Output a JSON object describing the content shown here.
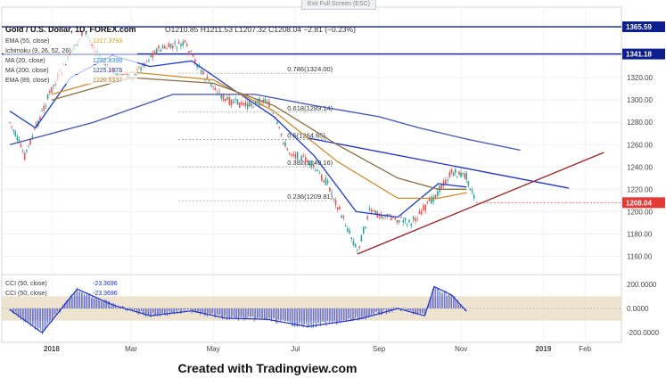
{
  "header": {
    "exit_fullscreen": "Exit Full Screen (ESC)",
    "symbol": "Gold / U.S. Dollar, 1D, FOREX.com",
    "ohlc": "O1210.85  H1211.53  L1207.32  C1208.04  −2.81 (−0.23%)"
  },
  "legend": [
    {
      "label": "EMA (55, close)",
      "value": "1217.3793",
      "color": "#d4a017"
    },
    {
      "label": "Ichimoku (9, 26, 52, 26)",
      "value": "",
      "color": "#1e88e5"
    },
    {
      "label": "MA (20, close)",
      "value": "1222.8398",
      "color": "#1e88e5"
    },
    {
      "label": "MA (200, close)",
      "value": "1225.1875",
      "color": "#2e3f9e"
    },
    {
      "label": "EMA (89, close)",
      "value": "1220.5337",
      "color": "#b07a2a"
    }
  ],
  "price_axis_ticks": [
    "1340.00",
    "1320.00",
    "1300.00",
    "1280.00",
    "1260.00",
    "1240.00",
    "1220.00",
    "1200.00",
    "1180.00",
    "1160.00"
  ],
  "price_badges": [
    {
      "text": "1365.59",
      "bg": "#0b1f8f"
    },
    {
      "text": "1341.18",
      "bg": "#0b1f8f"
    },
    {
      "text": "1208.04",
      "bg": "#e53935"
    }
  ],
  "fib_levels": [
    "0.786(1324.00)",
    "0.618(1289.14)",
    "0.5(1264.65)",
    "0.382(1240.16)",
    "0.236(1209.81)"
  ],
  "cci_legend": [
    {
      "label": "CCI (50, close)",
      "value": "-23.3696"
    },
    {
      "label": "CCI (50, close)",
      "value": "-23.3696"
    }
  ],
  "cci_axis_ticks": [
    "200.0000",
    "0.0000",
    "-200.0000"
  ],
  "time_axis_labels": [
    "2018",
    "Mar",
    "May",
    "Jul",
    "Sep",
    "Nov",
    "2019",
    "Feb"
  ],
  "caption": "Created with Tradingview.com",
  "colors": {
    "up_candle": "#26a69a",
    "down_candle": "#ef5350",
    "ma20": "#1a3bd6",
    "ma200": "#3f51b5",
    "ema55": "#d08a2c",
    "ema89": "#8d6e3f",
    "horizontal_lines": "#0b1f8f",
    "resistance_trendline": "#1a2fd0",
    "support_trendline": "#9b1c1c",
    "cci_line": "#1a2fd0",
    "cci_band": "#e8dcc3"
  },
  "chart_data": {
    "type": "line",
    "title": "Gold / U.S. Dollar, 1D, FOREX.com",
    "y_range": [
      1150,
      1372
    ],
    "x_labels": [
      "2018",
      "Mar",
      "May",
      "Jul",
      "Sep",
      "Nov",
      "2019",
      "Feb"
    ],
    "series": [
      {
        "name": "Gold / U.S. Dollar",
        "x": [
          "2017-12-01",
          "2017-12-12",
          "2018-01-01",
          "2018-01-25",
          "2018-02-10",
          "2018-03-01",
          "2018-03-20",
          "2018-04-10",
          "2018-04-25",
          "2018-05-10",
          "2018-05-25",
          "2018-06-10",
          "2018-06-25",
          "2018-07-10",
          "2018-07-25",
          "2018-08-16",
          "2018-08-25",
          "2018-09-10",
          "2018-09-25",
          "2018-10-10",
          "2018-10-25",
          "2018-11-05",
          "2018-11-12"
        ],
        "values": [
          1280,
          1250,
          1310,
          1362,
          1330,
          1320,
          1345,
          1350,
          1320,
          1300,
          1295,
          1300,
          1255,
          1245,
          1225,
          1165,
          1200,
          1195,
          1190,
          1210,
          1235,
          1232,
          1208
        ]
      },
      {
        "name": "MA (20, close)",
        "x": [
          "2017-12-01",
          "2017-12-20",
          "2018-01-15",
          "2018-02-15",
          "2018-03-15",
          "2018-04-15",
          "2018-05-15",
          "2018-06-15",
          "2018-07-15",
          "2018-08-15",
          "2018-09-15",
          "2018-10-15",
          "2018-11-05"
        ],
        "values": [
          1290,
          1275,
          1320,
          1340,
          1330,
          1335,
          1310,
          1285,
          1250,
          1200,
          1195,
          1225,
          1222
        ]
      },
      {
        "name": "MA (200, close)",
        "x": [
          "2017-12-01",
          "2018-02-01",
          "2018-04-01",
          "2018-06-01",
          "2018-07-15",
          "2018-09-01",
          "2018-10-01",
          "2018-11-05",
          "2018-12-15"
        ],
        "values": [
          1260,
          1280,
          1305,
          1305,
          1295,
          1285,
          1275,
          1265,
          1255
        ]
      },
      {
        "name": "EMA (55, close)",
        "x": [
          "2018-01-01",
          "2018-03-01",
          "2018-05-01",
          "2018-06-15",
          "2018-08-01",
          "2018-09-15",
          "2018-10-15",
          "2018-11-05"
        ],
        "values": [
          1305,
          1325,
          1318,
          1290,
          1245,
          1212,
          1212,
          1217
        ]
      },
      {
        "name": "EMA (89, close)",
        "x": [
          "2018-01-01",
          "2018-03-01",
          "2018-05-01",
          "2018-06-15",
          "2018-08-01",
          "2018-09-15",
          "2018-10-15",
          "2018-11-05"
        ],
        "values": [
          1300,
          1320,
          1315,
          1295,
          1260,
          1230,
          1220,
          1220
        ]
      }
    ],
    "horizontal_levels": [
      1365.59,
      1341.18
    ],
    "fib_retracements": [
      {
        "ratio": 0.786,
        "value": 1324.0
      },
      {
        "ratio": 0.618,
        "value": 1289.14
      },
      {
        "ratio": 0.5,
        "value": 1264.65
      },
      {
        "ratio": 0.382,
        "value": 1240.16
      },
      {
        "ratio": 0.236,
        "value": 1209.81
      }
    ],
    "trendlines": [
      {
        "name": "resistance",
        "from": [
          "2018-07-10",
          1266
        ],
        "to": [
          "2019-01-20",
          1221
        ]
      },
      {
        "name": "support",
        "from": [
          "2018-08-16",
          1162
        ],
        "to": [
          "2019-02-15",
          1253
        ]
      }
    ],
    "last_close": 1208.04,
    "cci": {
      "name": "CCI (50, close)",
      "last": -23.3696,
      "y_range": [
        -250,
        250
      ],
      "band": [
        -100,
        100
      ],
      "x": [
        "2017-12-01",
        "2017-12-25",
        "2018-01-20",
        "2018-02-15",
        "2018-03-15",
        "2018-04-15",
        "2018-05-10",
        "2018-06-10",
        "2018-07-10",
        "2018-08-10",
        "2018-08-20",
        "2018-09-15",
        "2018-10-05",
        "2018-10-12",
        "2018-10-25",
        "2018-11-05"
      ],
      "values": [
        -10,
        -200,
        160,
        30,
        -60,
        -20,
        -80,
        -90,
        -150,
        -100,
        -80,
        0,
        -60,
        180,
        110,
        -23
      ]
    }
  }
}
